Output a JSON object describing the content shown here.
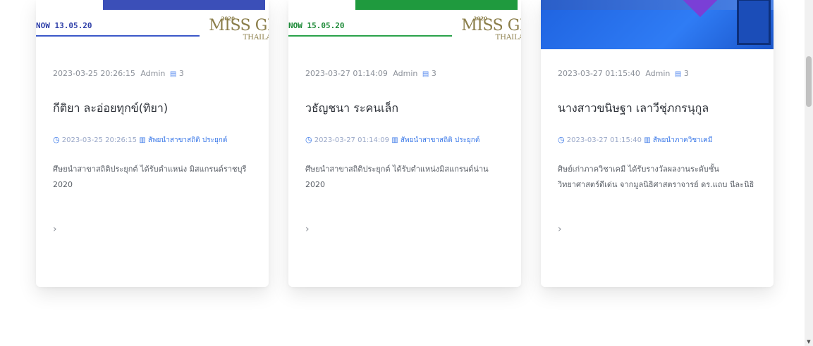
{
  "cards": [
    {
      "thumb": {
        "date": "NOW 13.05.20",
        "brand_top": "2020",
        "brand": "MISS GI",
        "brand_sub": "THAILA",
        "accent": "#3b4fb8",
        "rule": "#3b57c8"
      },
      "meta": {
        "datetime": "2023-03-25 20:26:15",
        "author": "Admin",
        "comments": "3"
      },
      "title": "กีติยา ละอ่อยทุกข์(ทิยา)",
      "tag_time": "2023-03-25 20:26:15",
      "tag_category": "สัพยนำสาขาสถิติ ประยุกต์",
      "excerpt": "ศึษยนำสาขาสถิติประยุกต์ ได้รับตำแหน่ง มิสแกรนด์ราชบุรี 2020",
      "more": "›"
    },
    {
      "thumb": {
        "date": "NOW 15.05.20",
        "brand_top": "2020",
        "brand": "MISS GI",
        "brand_sub": "THAILA",
        "accent": "#1f9a3e",
        "rule": "#2aa24a"
      },
      "meta": {
        "datetime": "2023-03-27 01:14:09",
        "author": "Admin",
        "comments": "3"
      },
      "title": "วธัญชนา ระคนเล็ก",
      "tag_time": "2023-03-27 01:14:09",
      "tag_category": "สัพยนำสาขาสถิติ ประยุกต์",
      "excerpt": "ศึษยนำสาขาสถิติประยุกต์ ได้รับตำแหน่งมิสแกรนด์น่าน 2020",
      "more": "›"
    },
    {
      "thumb": {
        "accent": "#2f7cf5"
      },
      "meta": {
        "datetime": "2023-03-27 01:15:40",
        "author": "Admin",
        "comments": "3"
      },
      "title": "นางสาวขนิษฐา เลาวีชุ่ภกรนุกูล",
      "tag_time": "2023-03-27 01:15:40",
      "tag_category": "สัพยนำภาควิชาเคมี",
      "excerpt": "ศิษย์เก่าภาควิชาเคมี ได้รับรางวัลผลงานระดับชั้นวิทยาศาสตร์ดีเด่น จากมูลนิธิศาสตราจารย์ ดร.แถบ นีละนิธิ",
      "more": "›"
    }
  ],
  "icons": {
    "comment": "comment-icon",
    "clock": "clock-icon",
    "category": "folder-icon",
    "more": "chevron-right-icon"
  }
}
